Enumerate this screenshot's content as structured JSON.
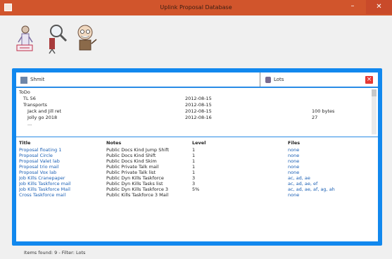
{
  "window": {
    "title": "Uplink Proposal Database",
    "controls": {
      "minimize": "–",
      "maximize": "□",
      "close": "✕"
    }
  },
  "toolbar": {
    "tools": [
      {
        "icon": "nurse-icon"
      },
      {
        "icon": "magnifier-icon"
      },
      {
        "icon": "old-man-icon"
      }
    ]
  },
  "search": {
    "query": "Shmit",
    "filter_value": "Lots"
  },
  "tree": {
    "root": "ToDo",
    "items": [
      {
        "label": "TL 56",
        "col2": "2012-08-15",
        "col3": ""
      },
      {
        "label": "Transports",
        "col2": "2012-08-15",
        "col3": ""
      },
      {
        "label": "Jack and Jill ret",
        "col2": "2012-08-15",
        "col3": "100 bytes"
      },
      {
        "label": "Jolly go 2018",
        "col2": "2012-08-16",
        "col3": "27"
      },
      {
        "label": "...",
        "col2": "",
        "col3": ""
      }
    ]
  },
  "table": {
    "headers": [
      "Title",
      "Notes",
      "Level",
      "Files"
    ],
    "rows": [
      [
        "Proposal floating 1",
        "Public Docs Kind Jump Shift",
        "1",
        "none"
      ],
      [
        "Proposal Circle",
        "Public Docs Kind Shift",
        "1",
        "none"
      ],
      [
        "Proposal Valet lab",
        "Public Docs Kind Skim",
        "1",
        "none"
      ],
      [
        "Proposal trio mail",
        "Public Private Talk mail",
        "1",
        "none"
      ],
      [
        "Proposal Vox lab",
        "Public Private Talk list",
        "1",
        "none"
      ],
      [
        "Job Kills Cranepaper",
        "Public Dyn Kills Taskforce",
        "3",
        "ac, ad, ae"
      ],
      [
        "Job Kills Taskforce mail",
        "Public Dyn Kills Tasks list",
        "3",
        "ac, ad, ae, ef"
      ],
      [
        "Job Kills Taskforce Mail",
        "Public Dyn Kills Taskforce 3",
        "5%",
        "ac, ad, ae, af, ag, ah"
      ],
      [
        "Cross Taskforce mail",
        "Public Kills Taskforce 3 Mail",
        "",
        "none"
      ]
    ]
  },
  "status": {
    "text": "Items found: 9 - Filter: Lots"
  }
}
